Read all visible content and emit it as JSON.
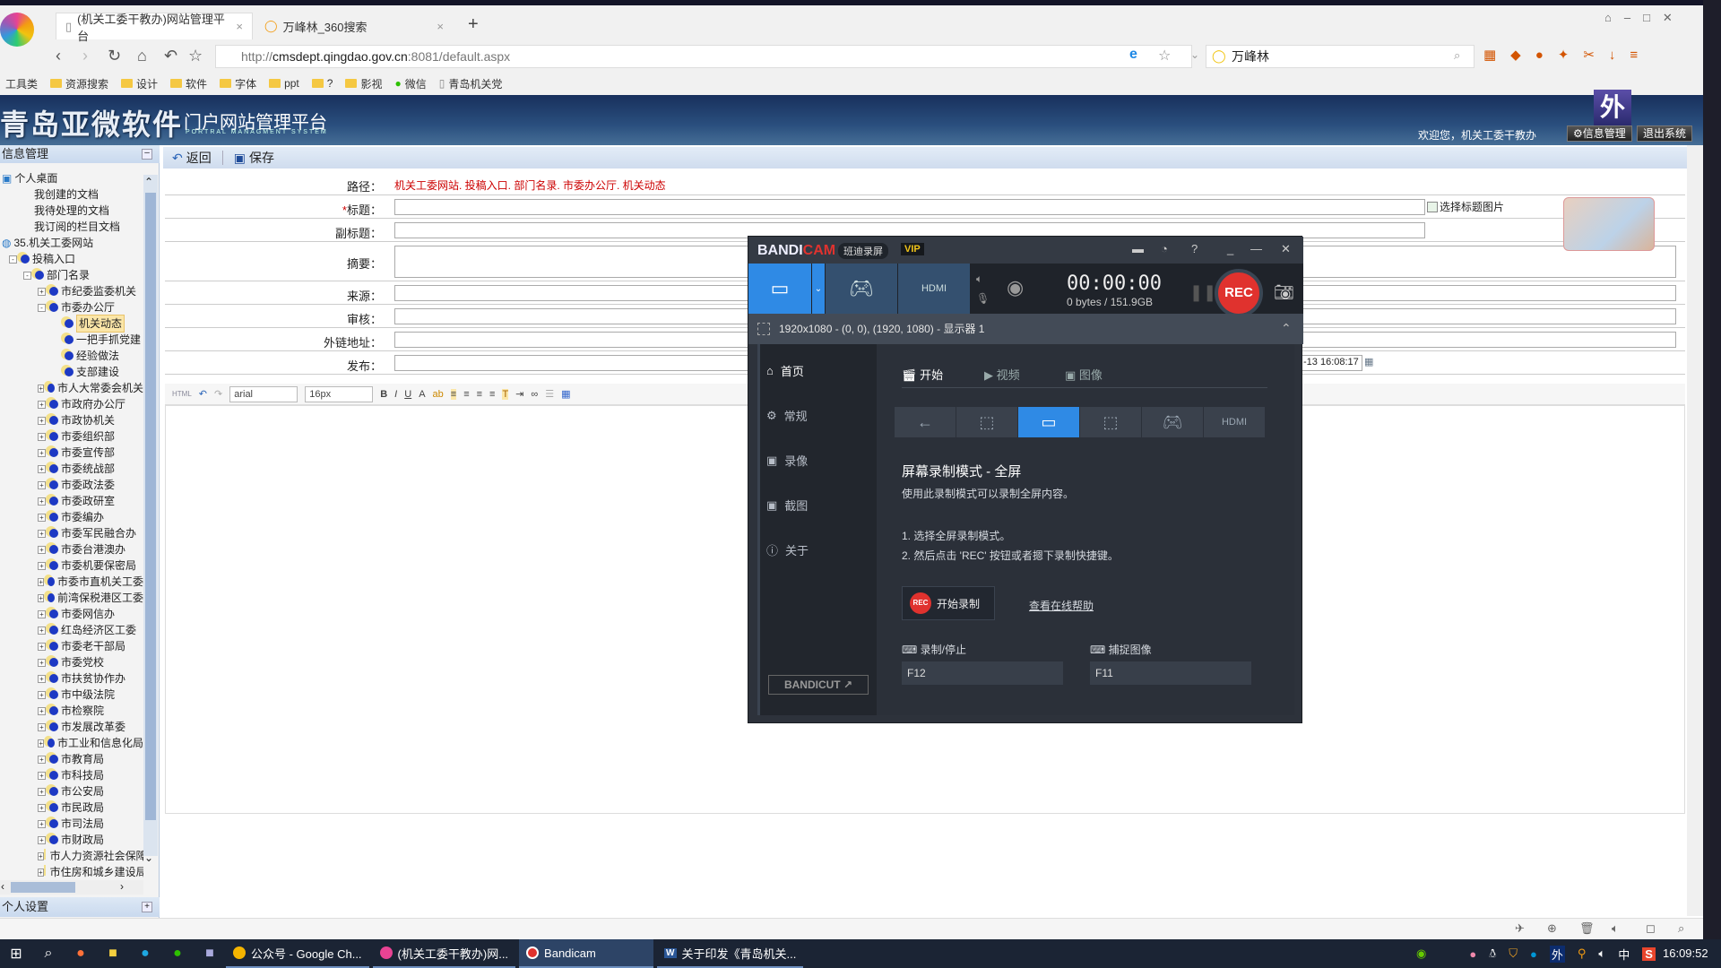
{
  "browser": {
    "tabs": [
      {
        "label": "(机关工委干教办)网站管理平台",
        "active": true
      },
      {
        "label": "万峰林_360搜索",
        "active": false
      }
    ],
    "new_tab_label": "+",
    "address_prefix": "http://",
    "address_host": "cmsdept.qingdao.gov.cn",
    "address_rest": ":8081/default.aspx",
    "search_value": "万峰林",
    "bookmarks": [
      {
        "label": "工具类",
        "type": "text"
      },
      {
        "label": "资源搜索",
        "type": "folder"
      },
      {
        "label": "设计",
        "type": "folder"
      },
      {
        "label": "软件",
        "type": "folder"
      },
      {
        "label": "字体",
        "type": "folder"
      },
      {
        "label": "ppt",
        "type": "folder"
      },
      {
        "label": "?",
        "type": "folder"
      },
      {
        "label": "影视",
        "type": "folder"
      },
      {
        "label": "微信",
        "type": "wechat"
      },
      {
        "label": "青岛机关党",
        "type": "page"
      }
    ]
  },
  "header": {
    "brand": "青岛亚微软件",
    "subtitle": "门户网站管理平台",
    "subtitle_en": "PORTRAL MANAGMENT SYSTEM",
    "badge": "外",
    "welcome": "欢迎您，机关工委干教办",
    "info_mgmt": "信息管理",
    "logout": "退出系统"
  },
  "left_panel": {
    "title": "信息管理",
    "footer": "个人设置",
    "tree": [
      {
        "label": "个人桌面",
        "level": 0,
        "kind": "desk"
      },
      {
        "label": "我创建的文档",
        "level": 2,
        "kind": "leaf-plain"
      },
      {
        "label": "我待处理的文档",
        "level": 2,
        "kind": "leaf-plain"
      },
      {
        "label": "我订阅的栏目文档",
        "level": 2,
        "kind": "leaf-plain"
      },
      {
        "label": "35.机关工委网站",
        "level": 0,
        "kind": "site"
      },
      {
        "label": "投稿入口",
        "level": 1,
        "kind": "node",
        "pm": "-"
      },
      {
        "label": "部门名录",
        "level": 2,
        "kind": "node",
        "pm": "-"
      },
      {
        "label": "市纪委监委机关",
        "level": 3,
        "kind": "node",
        "pm": "+"
      },
      {
        "label": "市委办公厅",
        "level": 3,
        "kind": "node",
        "pm": "-"
      },
      {
        "label": "机关动态",
        "level": 4,
        "kind": "leaf",
        "selected": true
      },
      {
        "label": "一把手抓党建",
        "level": 4,
        "kind": "leaf"
      },
      {
        "label": "经验做法",
        "level": 4,
        "kind": "leaf"
      },
      {
        "label": "支部建设",
        "level": 4,
        "kind": "leaf"
      },
      {
        "label": "市人大常委会机关",
        "level": 3,
        "kind": "node",
        "pm": "+"
      },
      {
        "label": "市政府办公厅",
        "level": 3,
        "kind": "node",
        "pm": "+"
      },
      {
        "label": "市政协机关",
        "level": 3,
        "kind": "node",
        "pm": "+"
      },
      {
        "label": "市委组织部",
        "level": 3,
        "kind": "node",
        "pm": "+"
      },
      {
        "label": "市委宣传部",
        "level": 3,
        "kind": "node",
        "pm": "+"
      },
      {
        "label": "市委统战部",
        "level": 3,
        "kind": "node",
        "pm": "+"
      },
      {
        "label": "市委政法委",
        "level": 3,
        "kind": "node",
        "pm": "+"
      },
      {
        "label": "市委政研室",
        "level": 3,
        "kind": "node",
        "pm": "+"
      },
      {
        "label": "市委编办",
        "level": 3,
        "kind": "node",
        "pm": "+"
      },
      {
        "label": "市委军民融合办",
        "level": 3,
        "kind": "node",
        "pm": "+"
      },
      {
        "label": "市委台港澳办",
        "level": 3,
        "kind": "node",
        "pm": "+"
      },
      {
        "label": "市委机要保密局",
        "level": 3,
        "kind": "node",
        "pm": "+"
      },
      {
        "label": "市委市直机关工委",
        "level": 3,
        "kind": "node",
        "pm": "+"
      },
      {
        "label": "前湾保税港区工委",
        "level": 3,
        "kind": "node",
        "pm": "+"
      },
      {
        "label": "市委网信办",
        "level": 3,
        "kind": "node",
        "pm": "+"
      },
      {
        "label": "红岛经济区工委",
        "level": 3,
        "kind": "node",
        "pm": "+"
      },
      {
        "label": "市委老干部局",
        "level": 3,
        "kind": "node",
        "pm": "+"
      },
      {
        "label": "市委党校",
        "level": 3,
        "kind": "node",
        "pm": "+"
      },
      {
        "label": "市扶贫协作办",
        "level": 3,
        "kind": "node",
        "pm": "+"
      },
      {
        "label": "市中级法院",
        "level": 3,
        "kind": "node",
        "pm": "+"
      },
      {
        "label": "市检察院",
        "level": 3,
        "kind": "node",
        "pm": "+"
      },
      {
        "label": "市发展改革委",
        "level": 3,
        "kind": "node",
        "pm": "+"
      },
      {
        "label": "市工业和信息化局",
        "level": 3,
        "kind": "node",
        "pm": "+"
      },
      {
        "label": "市教育局",
        "level": 3,
        "kind": "node",
        "pm": "+"
      },
      {
        "label": "市科技局",
        "level": 3,
        "kind": "node",
        "pm": "+"
      },
      {
        "label": "市公安局",
        "level": 3,
        "kind": "node",
        "pm": "+"
      },
      {
        "label": "市民政局",
        "level": 3,
        "kind": "node",
        "pm": "+"
      },
      {
        "label": "市司法局",
        "level": 3,
        "kind": "node",
        "pm": "+"
      },
      {
        "label": "市财政局",
        "level": 3,
        "kind": "node",
        "pm": "+"
      },
      {
        "label": "市人力资源社会保障局",
        "level": 3,
        "kind": "node",
        "pm": "+"
      },
      {
        "label": "市住房和城乡建设局",
        "level": 3,
        "kind": "node",
        "pm": "+"
      }
    ]
  },
  "toolbar": {
    "back": "返回",
    "save": "保存"
  },
  "form": {
    "path_label": "路径：",
    "path_value": "机关工委网站. 投稿入口. 部门名录. 市委办公厅. 机关动态",
    "title_required": "*",
    "title_label": "标题：",
    "title_value": "",
    "choose_title_image": "选择标题图片",
    "subtitle_label": "副标题：",
    "summary_label": "摘要：",
    "source_label": "来源：",
    "review_label": "审核：",
    "external_label": "外链地址：",
    "publish_label": "发布：",
    "publish_value": "-13 16:08:17"
  },
  "editor": {
    "font_family": "arial",
    "font_size": "16px",
    "buttons": [
      "HTML",
      "undo",
      "redo",
      "B",
      "I",
      "U",
      "A",
      "highlight",
      "align-left",
      "align-center",
      "align-right",
      "justify",
      "paste-text",
      "indent",
      "link",
      "list",
      "table"
    ]
  },
  "bandicam": {
    "logo_a": "BANDI",
    "logo_b": "CAM",
    "tag": "班迪录屏",
    "vip": "VIP",
    "timer": "00:00:00",
    "size": "0 bytes / 151.9GB",
    "rec": "REC",
    "resolution": "1920x1080 - (0, 0), (1920, 1080) - 显示器 1",
    "sidebar": [
      {
        "label": "首页",
        "icon": "home",
        "active": true
      },
      {
        "label": "常规",
        "icon": "gear"
      },
      {
        "label": "录像",
        "icon": "video-settings"
      },
      {
        "label": "截图",
        "icon": "image-settings"
      },
      {
        "label": "关于",
        "icon": "info"
      }
    ],
    "bandicut": "BANDICUT ↗",
    "tabs": [
      {
        "label": "开始",
        "active": true
      },
      {
        "label": "视频"
      },
      {
        "label": "图像"
      }
    ],
    "heading": "屏幕录制模式 - 全屏",
    "description": "使用此录制模式可以录制全屏内容。",
    "step1": "1. 选择全屏录制模式。",
    "step2": "2. 然后点击 'REC' 按钮或者摁下录制快捷键。",
    "start_rec": "开始录制",
    "start_rec_badge": "REC",
    "help_link": "查看在线帮助",
    "hotkey_record_label": "录制/停止",
    "hotkey_record_value": "F12",
    "hotkey_capture_label": "捕捉图像",
    "hotkey_capture_value": "F11"
  },
  "taskbar": {
    "apps": [
      {
        "label": "公众号 - Google Ch...",
        "color": "#f4b400"
      },
      {
        "label": "(机关工委干教办)网...",
        "color": "#e84393"
      },
      {
        "label": "Bandicam",
        "color": "#e0322e",
        "active": true
      },
      {
        "label": "关于印发《青岛机关...",
        "color": "#2b5797"
      }
    ],
    "ime": "中",
    "clock": "16:09:52"
  }
}
